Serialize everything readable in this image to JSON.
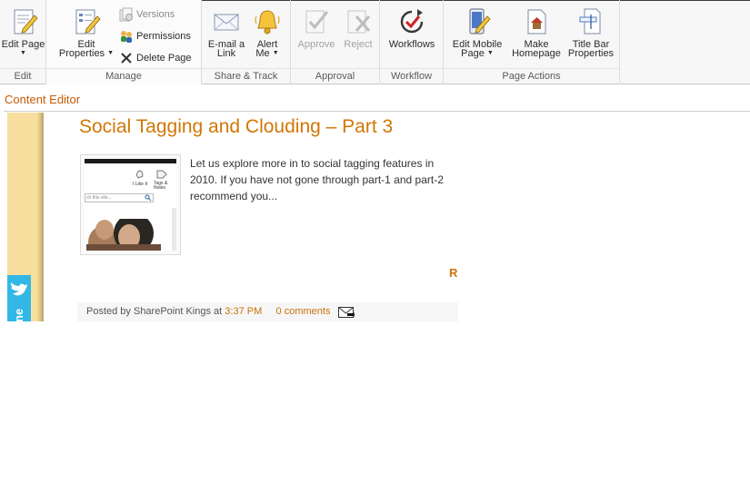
{
  "ribbon": {
    "groups": {
      "edit": "Edit",
      "manage": "Manage",
      "share_track": "Share & Track",
      "approval": "Approval",
      "workflow": "Workflow",
      "page_actions": "Page Actions"
    },
    "buttons": {
      "edit_page": "Edit Page",
      "edit_properties_1": "Edit",
      "edit_properties_2": "Properties",
      "versions": "Versions",
      "permissions": "Permissions",
      "delete_page": "Delete Page",
      "email_link_1": "E-mail a",
      "email_link_2": "Link",
      "alert_me_1": "Alert",
      "alert_me_2": "Me",
      "approve": "Approve",
      "reject": "Reject",
      "workflows": "Workflows",
      "edit_mobile_1": "Edit Mobile",
      "edit_mobile_2": "Page",
      "make_homepage_1": "Make",
      "make_homepage_2": "Homepage",
      "title_bar_1": "Title Bar",
      "title_bar_2": "Properties"
    },
    "icons": {
      "edit_page": "pencil-page-icon",
      "edit_properties": "properties-page-icon",
      "versions": "versions-icon",
      "permissions": "permissions-icon",
      "delete_page": "delete-x-icon",
      "email_link": "envelope-icon",
      "alert_me": "bell-icon",
      "approve": "approve-icon",
      "reject": "reject-icon",
      "workflows": "workflow-icon",
      "edit_mobile": "mobile-page-icon",
      "make_homepage": "homepage-icon",
      "title_bar": "title-bar-icon"
    }
  },
  "content_editor": {
    "title": "Content Editor"
  },
  "post": {
    "title": "Social Tagging and Clouding – Part 3",
    "body_lines": [
      "Let us explore more in to social tagging features in",
      "2010. If you have not gone through part-1 and part-2",
      "recommend you..."
    ],
    "read_more": "R",
    "thumbnail_texts": {
      "label1": "I Like It",
      "label2": "Tags & Notes",
      "search_placeholder": "ch this site..."
    },
    "footer": {
      "posted_by": "Posted by SharePoint Kings at",
      "time": "3:37 PM",
      "comments": "0 comments"
    }
  },
  "sidebar": {
    "twitter_text": "ne"
  },
  "colors": {
    "accent_orange": "#d27606",
    "ribbon_bg": "#f7f7f7",
    "twitter_blue": "#33b7e6"
  }
}
